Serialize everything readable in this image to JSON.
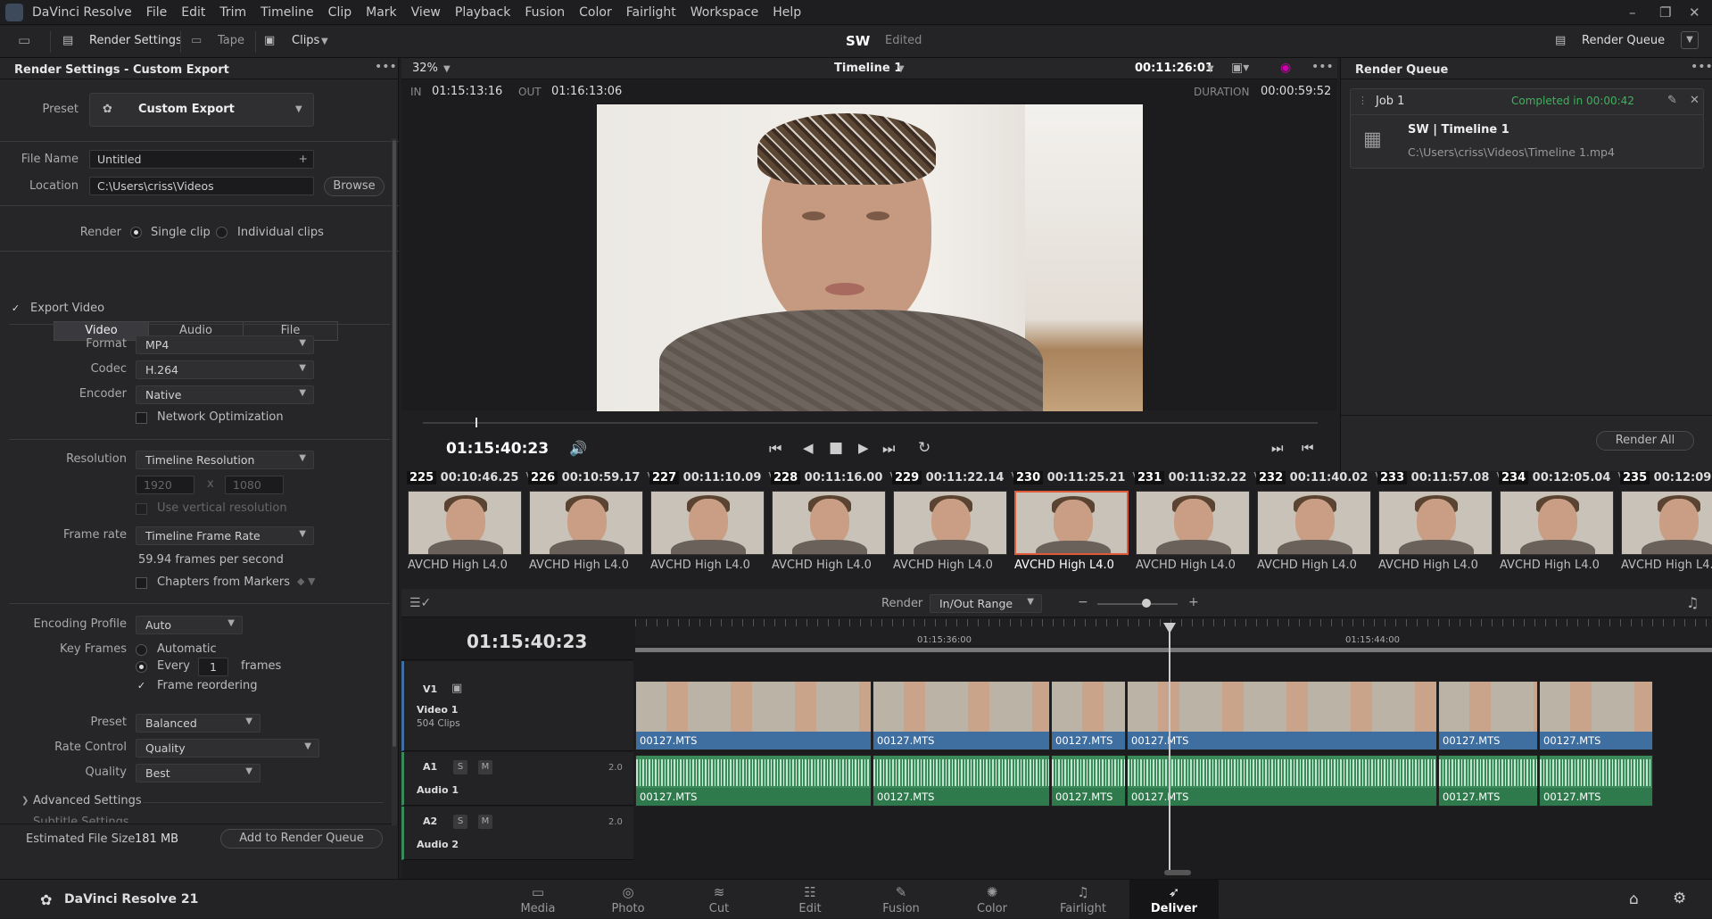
{
  "app": {
    "name": "DaVinci Resolve",
    "version_label": "DaVinci Resolve 21"
  },
  "menu": [
    "DaVinci Resolve",
    "File",
    "Edit",
    "Trim",
    "Timeline",
    "Clip",
    "Mark",
    "View",
    "Playback",
    "Fusion",
    "Color",
    "Fairlight",
    "Workspace",
    "Help"
  ],
  "toolbar": {
    "render_settings": "Render Settings",
    "tape": "Tape",
    "clips": "Clips",
    "project": "SW",
    "status": "Edited",
    "render_queue": "Render Queue"
  },
  "render_settings": {
    "title": "Render Settings - Custom Export",
    "preset_label": "Preset",
    "preset_value": "Custom Export",
    "filename_label": "File Name",
    "filename_value": "Untitled",
    "location_label": "Location",
    "location_value": "C:\\Users\\criss\\Videos",
    "browse": "Browse",
    "render_label": "Render",
    "single_clip": "Single clip",
    "individual_clips": "Individual clips",
    "tabs": [
      "Video",
      "Audio",
      "File"
    ],
    "export_video": "Export Video",
    "format_label": "Format",
    "format_value": "MP4",
    "codec_label": "Codec",
    "codec_value": "H.264",
    "encoder_label": "Encoder",
    "encoder_value": "Native",
    "network_opt": "Network Optimization",
    "resolution_label": "Resolution",
    "resolution_value": "Timeline Resolution",
    "res_w": "1920",
    "res_x": "x",
    "res_h": "1080",
    "vertical_res": "Use vertical resolution",
    "framerate_label": "Frame rate",
    "framerate_value": "Timeline Frame Rate",
    "fps_text": "59.94 frames per second",
    "chapters": "Chapters from Markers",
    "enc_profile_label": "Encoding Profile",
    "enc_profile_value": "Auto",
    "keyframes_label": "Key Frames",
    "kf_auto": "Automatic",
    "kf_every": "Every",
    "kf_every_value": "1",
    "kf_frames": "frames",
    "frame_reordering": "Frame reordering",
    "preset2_label": "Preset",
    "preset2_value": "Balanced",
    "rate_label": "Rate Control",
    "rate_value": "Quality",
    "quality_label": "Quality",
    "quality_value": "Best",
    "advanced": "Advanced Settings",
    "subtitle": "Subtitle Settings",
    "est_label": "Estimated File Size",
    "est_value": "181 MB",
    "add_queue": "Add to Render Queue"
  },
  "viewer": {
    "zoom": "32%",
    "timeline_name": "Timeline 1",
    "timecode_top": "00:11:26:01",
    "in_label": "IN",
    "in_value": "01:15:13:16",
    "out_label": "OUT",
    "out_value": "01:16:13:06",
    "duration_label": "DURATION",
    "duration_value": "00:00:59:52",
    "current_tc": "01:15:40:23"
  },
  "render_queue": {
    "title": "Render Queue",
    "job": "Job 1",
    "job_status": "Completed in 00:00:42",
    "job_title": "SW | Timeline 1",
    "job_path": "C:\\Users\\criss\\Videos\\Timeline 1.mp4",
    "render_all": "Render All"
  },
  "thumbnails": [
    {
      "num": "225",
      "tc": "00:10:46.25",
      "track": "V1",
      "codec": "AVCHD High L4.0"
    },
    {
      "num": "226",
      "tc": "00:10:59.17",
      "track": "V1",
      "codec": "AVCHD High L4.0"
    },
    {
      "num": "227",
      "tc": "00:11:10.09",
      "track": "V1",
      "codec": "AVCHD High L4.0"
    },
    {
      "num": "228",
      "tc": "00:11:16.00",
      "track": "V1",
      "codec": "AVCHD High L4.0"
    },
    {
      "num": "229",
      "tc": "00:11:22.14",
      "track": "V1",
      "codec": "AVCHD High L4.0"
    },
    {
      "num": "230",
      "tc": "00:11:25.21",
      "track": "V1",
      "codec": "AVCHD High L4.0"
    },
    {
      "num": "231",
      "tc": "00:11:32.22",
      "track": "V1",
      "codec": "AVCHD High L4.0"
    },
    {
      "num": "232",
      "tc": "00:11:40.02",
      "track": "V1",
      "codec": "AVCHD High L4.0"
    },
    {
      "num": "233",
      "tc": "00:11:57.08",
      "track": "V1",
      "codec": "AVCHD High L4.0"
    },
    {
      "num": "234",
      "tc": "00:12:05.04",
      "track": "V1",
      "codec": "AVCHD High L4.0"
    },
    {
      "num": "235",
      "tc": "00:12:09.19",
      "track": "",
      "codec": "AVCHD High L4.0"
    }
  ],
  "timeline": {
    "render_label": "Render",
    "render_value": "In/Out Range",
    "timecode": "01:15:40:23",
    "ruler_1": "01:15:36:00",
    "ruler_2": "01:15:44:00",
    "v1_tag": "V1",
    "v1_name": "Video 1",
    "v1_count": "504 Clips",
    "a1_tag": "A1",
    "a1_name": "Audio 1",
    "a1_level": "2.0",
    "a2_tag": "A2",
    "a2_name": "Audio 2",
    "a2_level": "2.0",
    "s": "S",
    "m": "M",
    "clip_name": "00127.MTS"
  },
  "pages": [
    "Media",
    "Photo",
    "Cut",
    "Edit",
    "Fusion",
    "Color",
    "Fairlight",
    "Deliver"
  ]
}
